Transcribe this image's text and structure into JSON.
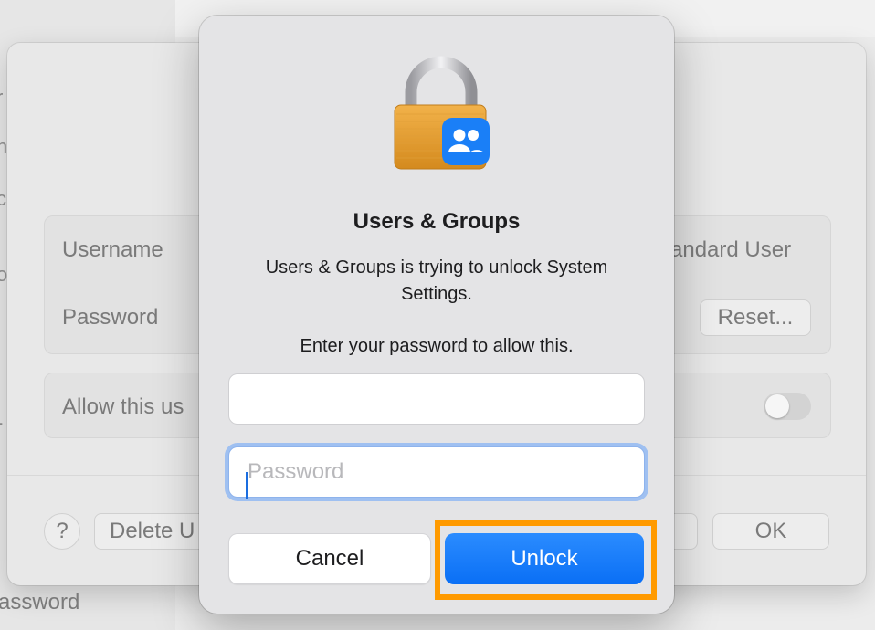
{
  "background": {
    "sidebar_fragments": [
      "r",
      "h",
      "c",
      "o",
      "-"
    ],
    "username_label": "Username",
    "password_label": "Password",
    "account_type": "andard User",
    "reset_label": "Reset...",
    "allow_label": "Allow this us",
    "help_label": "?",
    "delete_label": "Delete U",
    "ok_label": "OK",
    "bottom_label": "assword"
  },
  "dialog": {
    "title": "Users & Groups",
    "message": "Users & Groups is trying to unlock System Settings.",
    "prompt": "Enter your password to allow this.",
    "username_value": "",
    "password_placeholder": "Password",
    "cancel_label": "Cancel",
    "unlock_label": "Unlock",
    "icon": "lock-users-icon",
    "accent_color": "#0a6ff5",
    "highlight_color": "#ff9a00"
  }
}
